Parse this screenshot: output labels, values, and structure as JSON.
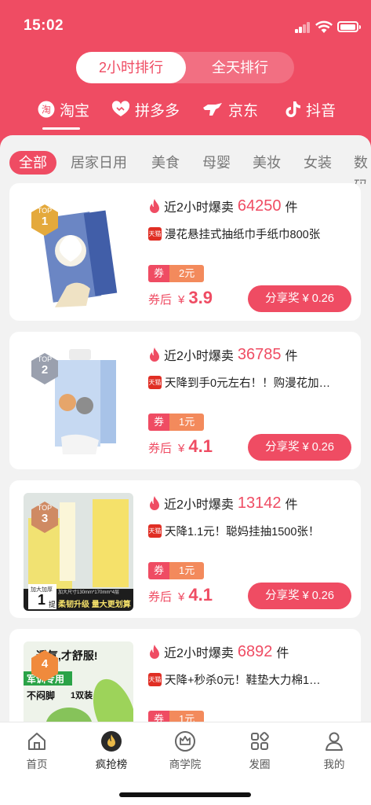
{
  "status": {
    "time": "15:02"
  },
  "toggle": {
    "active": "2小时排行",
    "inactive": "全天排行"
  },
  "platforms": [
    "淘宝",
    "拼多多",
    "京东",
    "抖音"
  ],
  "categories": [
    "全部",
    "居家日用",
    "美食",
    "母婴",
    "美妆",
    "女装",
    "数码"
  ],
  "items": [
    {
      "rank_top": "TOP",
      "rank": "1",
      "prefix": "近2小时爆卖",
      "count": "64250",
      "unit": "件",
      "title": "漫花悬挂式抽纸巾手纸巾800张",
      "tmall": "天猫",
      "coupon_label": "券",
      "coupon_value": "2元",
      "after_label": "券后",
      "currency": "¥",
      "price": "3.9",
      "share": "分享奖 ¥ 0.26"
    },
    {
      "rank_top": "TOP",
      "rank": "2",
      "prefix": "近2小时爆卖",
      "count": "36785",
      "unit": "件",
      "title": "天降到手0元左右！！购漫花加…",
      "tmall": "天猫",
      "coupon_label": "券",
      "coupon_value": "1元",
      "after_label": "券后",
      "currency": "¥",
      "price": "4.1",
      "share": "分享奖 ¥ 0.26"
    },
    {
      "rank_top": "TOP",
      "rank": "3",
      "prefix": "近2小时爆卖",
      "count": "13142",
      "unit": "件",
      "title": "天降1.1元！聪妈挂抽1500张！",
      "tmall": "天猫",
      "coupon_label": "券",
      "coupon_value": "1元",
      "after_label": "券后",
      "currency": "¥",
      "price": "4.1",
      "share": "分享奖 ¥ 0.26",
      "img_text": {
        "a": "加大加厚",
        "b": "1",
        "c": "提",
        "d": "加大尺寸130mm*170mm*4层",
        "e": "柔韧升级 量大更划算"
      }
    },
    {
      "rank_top": "",
      "rank": "4",
      "prefix": "近2小时爆卖",
      "count": "6892",
      "unit": "件",
      "title": "天降+秒杀0元！鞋垫大力棉1…",
      "tmall": "天猫",
      "coupon_label": "券",
      "coupon_value": "1元",
      "img_text": {
        "a": "透气,才舒服!",
        "b": "军训专用",
        "c": "不闷脚",
        "d": "1双装"
      }
    }
  ],
  "tabs": [
    "首页",
    "疯抢榜",
    "商学院",
    "发圈",
    "我的"
  ],
  "colors": {
    "brand": "#ef4c63",
    "coupon": "#f38a5c"
  }
}
